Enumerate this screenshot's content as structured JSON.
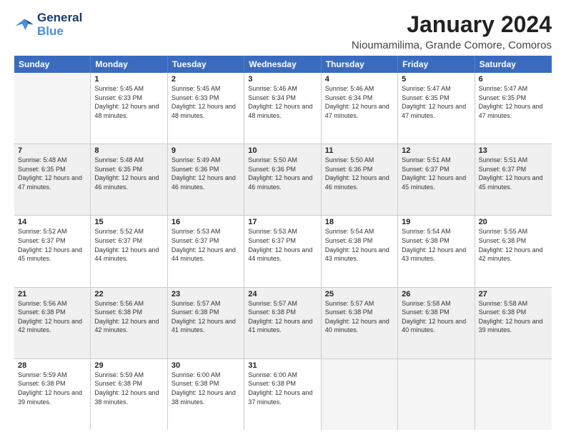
{
  "header": {
    "logo_line1": "General",
    "logo_line2": "Blue",
    "main_title": "January 2024",
    "subtitle": "Nioumamilima, Grande Comore, Comoros"
  },
  "calendar": {
    "days_of_week": [
      "Sunday",
      "Monday",
      "Tuesday",
      "Wednesday",
      "Thursday",
      "Friday",
      "Saturday"
    ],
    "weeks": [
      [
        {
          "day": "",
          "sunrise": "",
          "sunset": "",
          "daylight": "",
          "empty": true
        },
        {
          "day": "1",
          "sunrise": "Sunrise: 5:45 AM",
          "sunset": "Sunset: 6:33 PM",
          "daylight": "Daylight: 12 hours and 48 minutes."
        },
        {
          "day": "2",
          "sunrise": "Sunrise: 5:45 AM",
          "sunset": "Sunset: 6:33 PM",
          "daylight": "Daylight: 12 hours and 48 minutes."
        },
        {
          "day": "3",
          "sunrise": "Sunrise: 5:46 AM",
          "sunset": "Sunset: 6:34 PM",
          "daylight": "Daylight: 12 hours and 48 minutes."
        },
        {
          "day": "4",
          "sunrise": "Sunrise: 5:46 AM",
          "sunset": "Sunset: 6:34 PM",
          "daylight": "Daylight: 12 hours and 47 minutes."
        },
        {
          "day": "5",
          "sunrise": "Sunrise: 5:47 AM",
          "sunset": "Sunset: 6:35 PM",
          "daylight": "Daylight: 12 hours and 47 minutes."
        },
        {
          "day": "6",
          "sunrise": "Sunrise: 5:47 AM",
          "sunset": "Sunset: 6:35 PM",
          "daylight": "Daylight: 12 hours and 47 minutes."
        }
      ],
      [
        {
          "day": "7",
          "sunrise": "Sunrise: 5:48 AM",
          "sunset": "Sunset: 6:35 PM",
          "daylight": "Daylight: 12 hours and 47 minutes."
        },
        {
          "day": "8",
          "sunrise": "Sunrise: 5:48 AM",
          "sunset": "Sunset: 6:35 PM",
          "daylight": "Daylight: 12 hours and 46 minutes."
        },
        {
          "day": "9",
          "sunrise": "Sunrise: 5:49 AM",
          "sunset": "Sunset: 6:36 PM",
          "daylight": "Daylight: 12 hours and 46 minutes."
        },
        {
          "day": "10",
          "sunrise": "Sunrise: 5:50 AM",
          "sunset": "Sunset: 6:36 PM",
          "daylight": "Daylight: 12 hours and 46 minutes."
        },
        {
          "day": "11",
          "sunrise": "Sunrise: 5:50 AM",
          "sunset": "Sunset: 6:36 PM",
          "daylight": "Daylight: 12 hours and 46 minutes."
        },
        {
          "day": "12",
          "sunrise": "Sunrise: 5:51 AM",
          "sunset": "Sunset: 6:37 PM",
          "daylight": "Daylight: 12 hours and 45 minutes."
        },
        {
          "day": "13",
          "sunrise": "Sunrise: 5:51 AM",
          "sunset": "Sunset: 6:37 PM",
          "daylight": "Daylight: 12 hours and 45 minutes."
        }
      ],
      [
        {
          "day": "14",
          "sunrise": "Sunrise: 5:52 AM",
          "sunset": "Sunset: 6:37 PM",
          "daylight": "Daylight: 12 hours and 45 minutes."
        },
        {
          "day": "15",
          "sunrise": "Sunrise: 5:52 AM",
          "sunset": "Sunset: 6:37 PM",
          "daylight": "Daylight: 12 hours and 44 minutes."
        },
        {
          "day": "16",
          "sunrise": "Sunrise: 5:53 AM",
          "sunset": "Sunset: 6:37 PM",
          "daylight": "Daylight: 12 hours and 44 minutes."
        },
        {
          "day": "17",
          "sunrise": "Sunrise: 5:53 AM",
          "sunset": "Sunset: 6:37 PM",
          "daylight": "Daylight: 12 hours and 44 minutes."
        },
        {
          "day": "18",
          "sunrise": "Sunrise: 5:54 AM",
          "sunset": "Sunset: 6:38 PM",
          "daylight": "Daylight: 12 hours and 43 minutes."
        },
        {
          "day": "19",
          "sunrise": "Sunrise: 5:54 AM",
          "sunset": "Sunset: 6:38 PM",
          "daylight": "Daylight: 12 hours and 43 minutes."
        },
        {
          "day": "20",
          "sunrise": "Sunrise: 5:55 AM",
          "sunset": "Sunset: 6:38 PM",
          "daylight": "Daylight: 12 hours and 42 minutes."
        }
      ],
      [
        {
          "day": "21",
          "sunrise": "Sunrise: 5:56 AM",
          "sunset": "Sunset: 6:38 PM",
          "daylight": "Daylight: 12 hours and 42 minutes."
        },
        {
          "day": "22",
          "sunrise": "Sunrise: 5:56 AM",
          "sunset": "Sunset: 6:38 PM",
          "daylight": "Daylight: 12 hours and 42 minutes."
        },
        {
          "day": "23",
          "sunrise": "Sunrise: 5:57 AM",
          "sunset": "Sunset: 6:38 PM",
          "daylight": "Daylight: 12 hours and 41 minutes."
        },
        {
          "day": "24",
          "sunrise": "Sunrise: 5:57 AM",
          "sunset": "Sunset: 6:38 PM",
          "daylight": "Daylight: 12 hours and 41 minutes."
        },
        {
          "day": "25",
          "sunrise": "Sunrise: 5:57 AM",
          "sunset": "Sunset: 6:38 PM",
          "daylight": "Daylight: 12 hours and 40 minutes."
        },
        {
          "day": "26",
          "sunrise": "Sunrise: 5:58 AM",
          "sunset": "Sunset: 6:38 PM",
          "daylight": "Daylight: 12 hours and 40 minutes."
        },
        {
          "day": "27",
          "sunrise": "Sunrise: 5:58 AM",
          "sunset": "Sunset: 6:38 PM",
          "daylight": "Daylight: 12 hours and 39 minutes."
        }
      ],
      [
        {
          "day": "28",
          "sunrise": "Sunrise: 5:59 AM",
          "sunset": "Sunset: 6:38 PM",
          "daylight": "Daylight: 12 hours and 39 minutes."
        },
        {
          "day": "29",
          "sunrise": "Sunrise: 5:59 AM",
          "sunset": "Sunset: 6:38 PM",
          "daylight": "Daylight: 12 hours and 38 minutes."
        },
        {
          "day": "30",
          "sunrise": "Sunrise: 6:00 AM",
          "sunset": "Sunset: 6:38 PM",
          "daylight": "Daylight: 12 hours and 38 minutes."
        },
        {
          "day": "31",
          "sunrise": "Sunrise: 6:00 AM",
          "sunset": "Sunset: 6:38 PM",
          "daylight": "Daylight: 12 hours and 37 minutes."
        },
        {
          "day": "",
          "sunrise": "",
          "sunset": "",
          "daylight": "",
          "empty": true
        },
        {
          "day": "",
          "sunrise": "",
          "sunset": "",
          "daylight": "",
          "empty": true
        },
        {
          "day": "",
          "sunrise": "",
          "sunset": "",
          "daylight": "",
          "empty": true
        }
      ]
    ]
  }
}
